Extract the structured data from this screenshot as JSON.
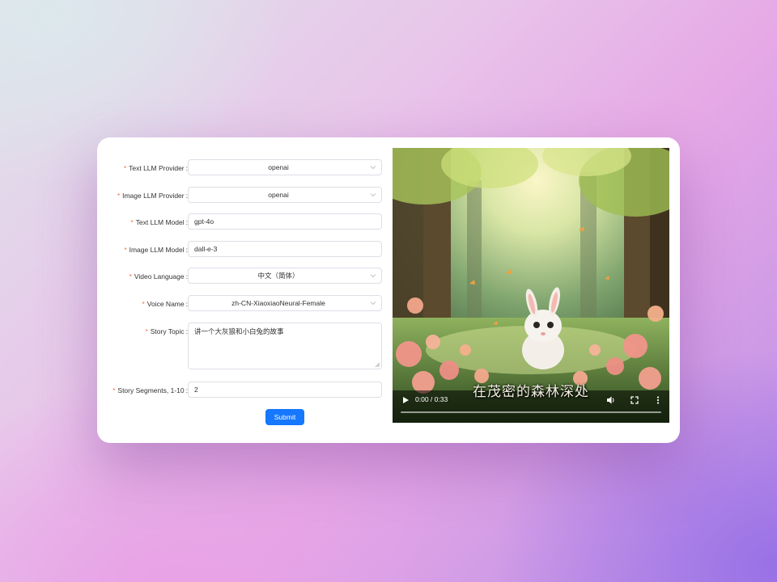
{
  "form": {
    "text_llm_provider": {
      "label": "Text LLM Provider",
      "value": "openai"
    },
    "image_llm_provider": {
      "label": "Image LLM Provider",
      "value": "openai"
    },
    "text_llm_model": {
      "label": "Text LLM Model",
      "value": "gpt-4o"
    },
    "image_llm_model": {
      "label": "Image LLM Model",
      "value": "dall-e-3"
    },
    "video_language": {
      "label": "Video Language",
      "value": "中文（简体）"
    },
    "voice_name": {
      "label": "Voice Name",
      "value": "zh-CN-XiaoxiaoNeural-Female"
    },
    "story_topic": {
      "label": "Story Topic",
      "value": "讲一个大灰狼和小白兔的故事"
    },
    "story_segments": {
      "label": "Story Segments, 1-10",
      "value": "2"
    },
    "required_mark": "*",
    "colon": ":",
    "submit_label": "Submit"
  },
  "video": {
    "subtitle": "在茂密的森林深处",
    "time": "0:00 / 0:33",
    "progress": 0
  },
  "colors": {
    "primary": "#1677ff",
    "required": "#f56c2d"
  },
  "icons": [
    "chevron-down-icon",
    "play-icon",
    "volume-icon",
    "fullscreen-icon",
    "more-vertical-icon",
    "resize-grip-icon"
  ]
}
